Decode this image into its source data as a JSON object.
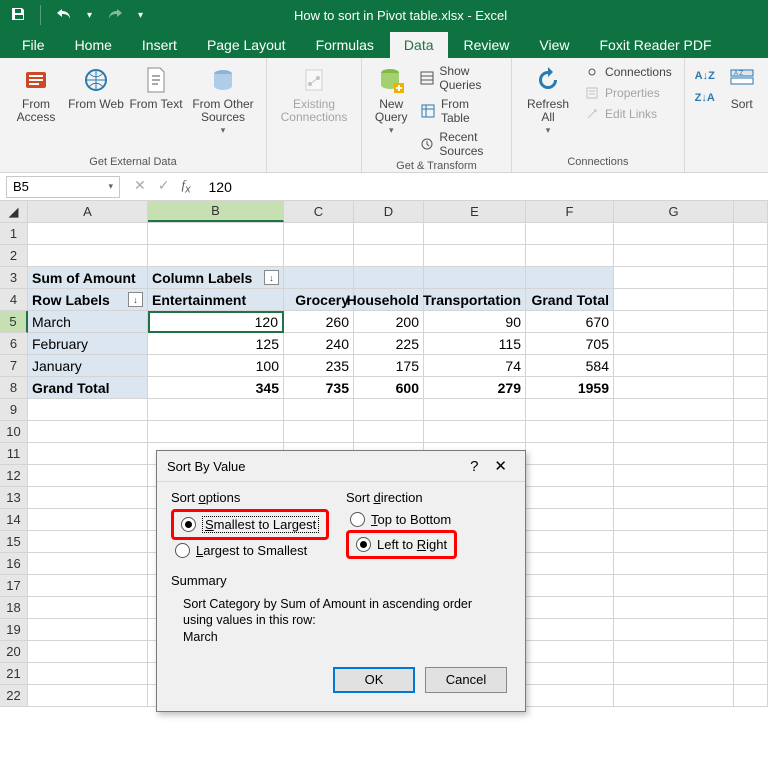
{
  "window": {
    "title": "How to sort in Pivot table.xlsx - Excel"
  },
  "tabs": {
    "file": "File",
    "home": "Home",
    "insert": "Insert",
    "page_layout": "Page Layout",
    "formulas": "Formulas",
    "data": "Data",
    "review": "Review",
    "view": "View",
    "foxit": "Foxit Reader PDF"
  },
  "ribbon": {
    "get_external": {
      "label": "Get External Data",
      "from_access": "From Access",
      "from_web": "From Web",
      "from_text": "From Text",
      "from_other": "From Other Sources"
    },
    "existing": {
      "label": "Existing Connections"
    },
    "get_transform": {
      "label": "Get & Transform",
      "new_query": "New Query",
      "show_queries": "Show Queries",
      "from_table": "From Table",
      "recent": "Recent Sources"
    },
    "connections": {
      "label": "Connections",
      "refresh_all": "Refresh All",
      "connections": "Connections",
      "properties": "Properties",
      "edit_links": "Edit Links"
    },
    "sort_filter": {
      "sort": "Sort"
    }
  },
  "namebox": {
    "ref": "B5",
    "formula_value": "120"
  },
  "columns": [
    "A",
    "B",
    "C",
    "D",
    "E",
    "F",
    "G"
  ],
  "pivot": {
    "sum_of_amount": "Sum of Amount",
    "column_labels": "Column Labels",
    "row_labels": "Row Labels",
    "cols": [
      "Entertainment",
      "Grocery",
      "Household",
      "Transportation",
      "Grand Total"
    ],
    "rows": [
      {
        "label": "March",
        "vals": [
          "120",
          "260",
          "200",
          "90",
          "670"
        ]
      },
      {
        "label": "February",
        "vals": [
          "125",
          "240",
          "225",
          "115",
          "705"
        ]
      },
      {
        "label": "January",
        "vals": [
          "100",
          "235",
          "175",
          "74",
          "584"
        ]
      }
    ],
    "total_label": "Grand Total",
    "totals": [
      "345",
      "735",
      "600",
      "279",
      "1959"
    ]
  },
  "dialog": {
    "title": "Sort By Value",
    "sort_options": "Sort options",
    "smallest": "Smallest to Largest",
    "largest": "Largest to Smallest",
    "sort_direction": "Sort direction",
    "top_bottom": "Top to Bottom",
    "left_right": "Left to Right",
    "summary_label": "Summary",
    "summary_text": "Sort Category by Sum of Amount in ascending order using values in this row:\nMarch",
    "ok": "OK",
    "cancel": "Cancel"
  }
}
